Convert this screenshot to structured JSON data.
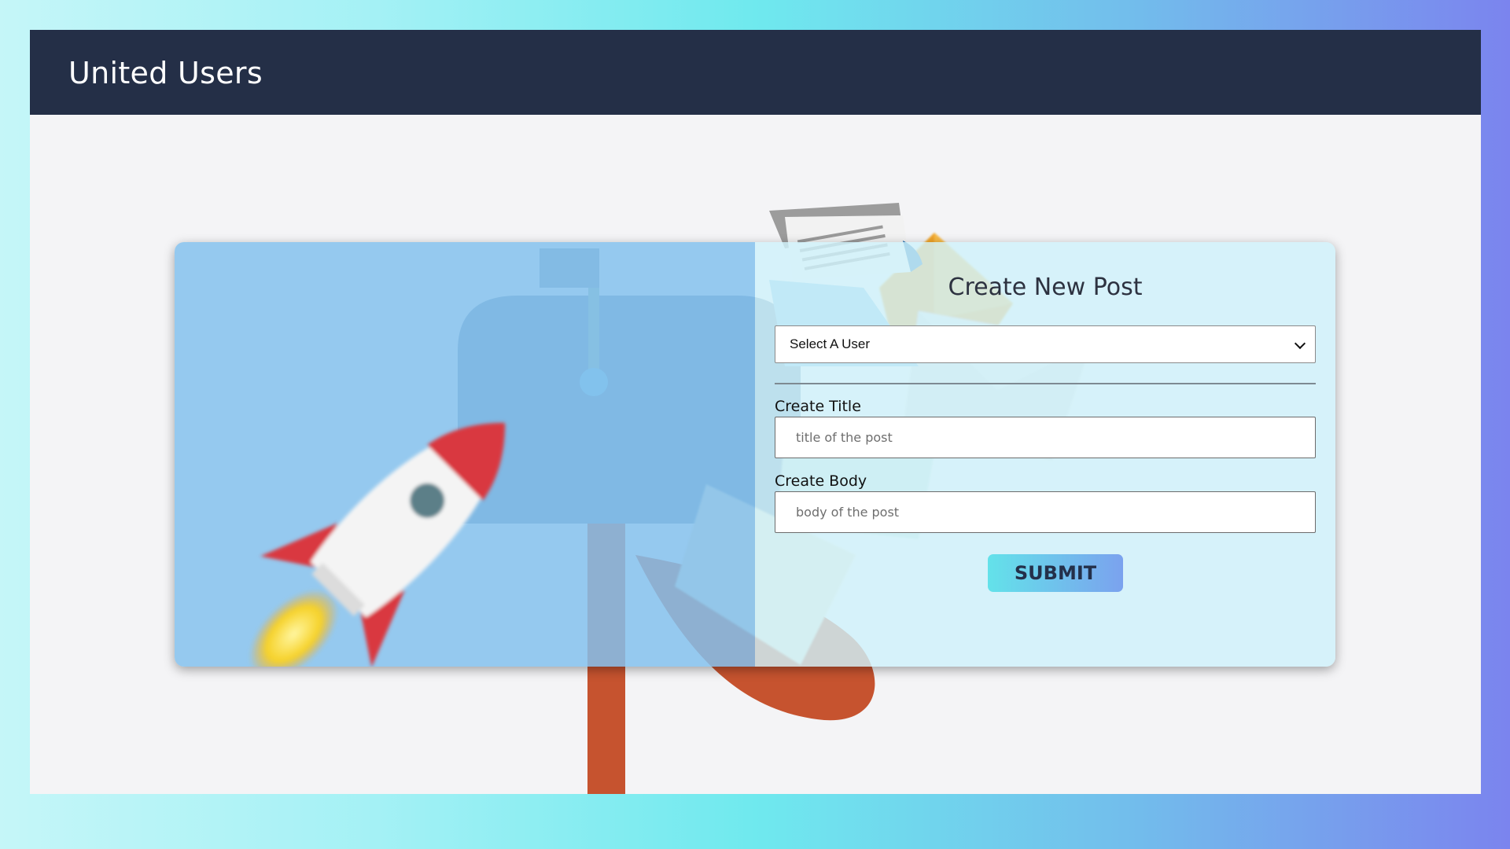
{
  "navbar": {
    "brand": "United Users"
  },
  "form": {
    "title": "Create New Post",
    "user_select": {
      "selected": "Select A User"
    },
    "title_field": {
      "label": "Create Title",
      "placeholder": "title of the post"
    },
    "body_field": {
      "label": "Create Body",
      "placeholder": "body of the post"
    },
    "submit_label": "SUBMIT"
  },
  "colors": {
    "navbar": "#242f47",
    "card_left": "#84c1ed",
    "card_right": "#d0f2fa",
    "button_gradient_start": "#63e2ea",
    "button_gradient_end": "#7ba2ee"
  },
  "icons": [
    "rocket-illustration",
    "mailbox-illustration",
    "envelope-illustration",
    "newspaper-illustration",
    "chevron-down-icon"
  ]
}
